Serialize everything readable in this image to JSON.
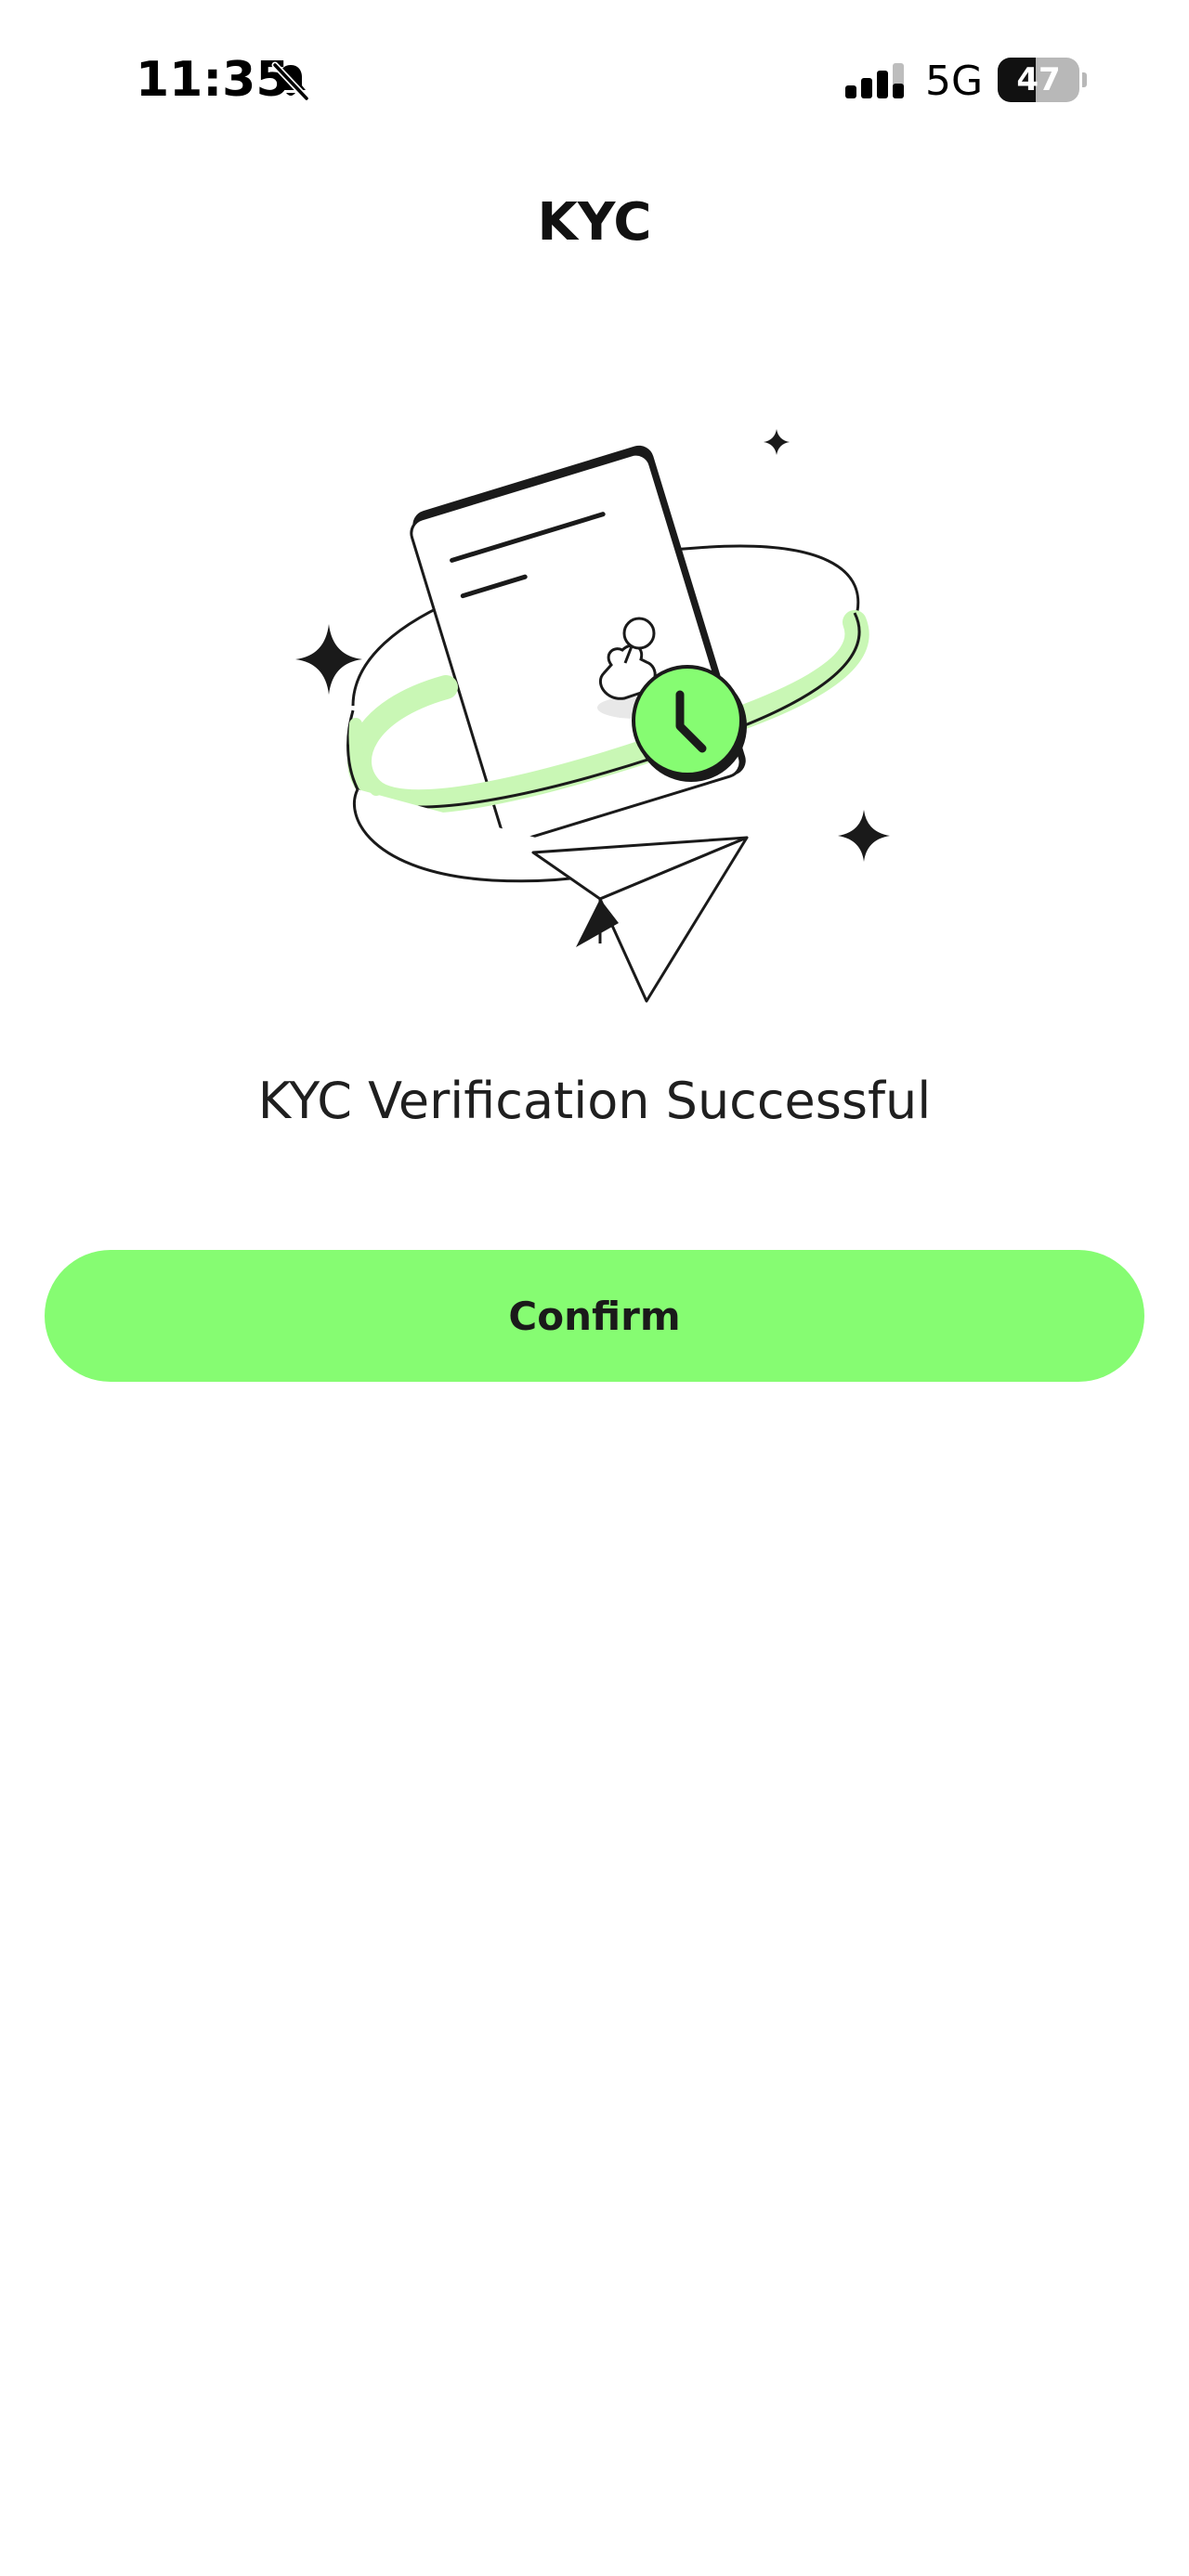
{
  "status_bar": {
    "time": "11:35",
    "network": "5G",
    "battery_level": "47",
    "battery_percent": 47,
    "icons": [
      "bell-muted-icon",
      "signal-icon",
      "battery-icon"
    ]
  },
  "header": {
    "title": "KYC"
  },
  "illustration": {
    "icons": [
      "document-icon",
      "stamp-icon",
      "clock-icon",
      "paper-plane-icon",
      "sparkle-icon"
    ],
    "accent_color": "#86fc72"
  },
  "main": {
    "message": "KYC Verification Successful",
    "confirm_label": "Confirm"
  },
  "colors": {
    "accent": "#86fc72",
    "text": "#1a1a1a",
    "background": "#ffffff"
  }
}
